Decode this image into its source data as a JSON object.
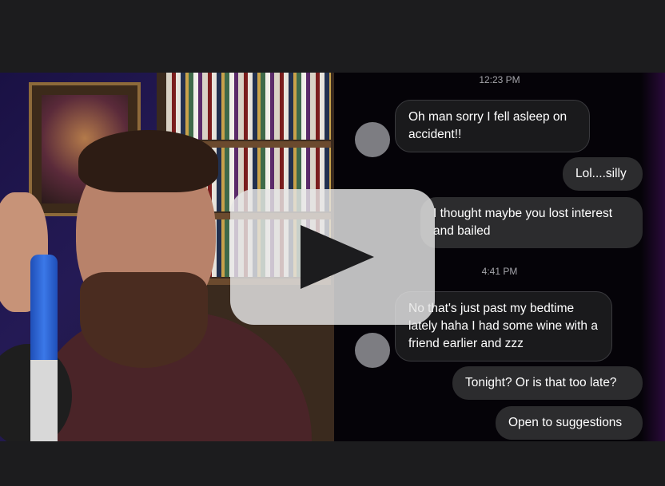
{
  "chat": {
    "timestamps": [
      "12:23 PM",
      "4:41 PM"
    ],
    "messages": [
      {
        "text": "Oh man sorry I fell asleep on accident!!"
      },
      {
        "text": "Lol....silly"
      },
      {
        "text": "I thought maybe you lost interest and bailed"
      },
      {
        "text": "No that's just past my bedtime lately haha I had some wine with a friend earlier and zzz"
      },
      {
        "text": "Tonight?  Or is that too late?"
      },
      {
        "text": "Open to suggestions"
      }
    ]
  },
  "video": {
    "play_icon": "play-icon",
    "colors": {
      "overlay": "#e6e6e6",
      "chat_bg": "#050308",
      "bar": "#1c1c1e"
    }
  }
}
